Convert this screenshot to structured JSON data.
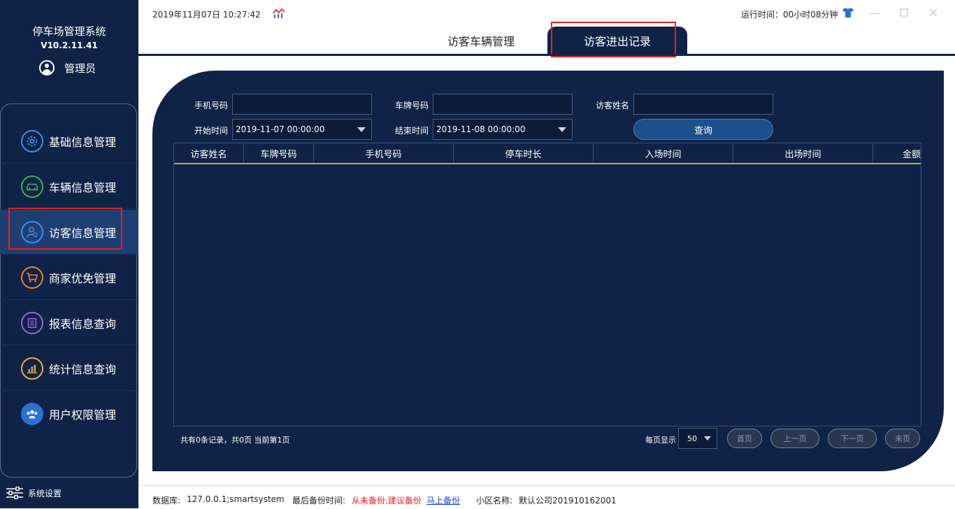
{
  "app": {
    "title": "停车场管理系统",
    "version": "V10.2.11.41",
    "user": "管理员"
  },
  "sidebar": {
    "items": [
      {
        "label": "基础信息管理",
        "icon": "gear-icon",
        "color": "#3f8ee8"
      },
      {
        "label": "车辆信息管理",
        "icon": "car-icon",
        "color": "#3fae5a"
      },
      {
        "label": "访客信息管理",
        "icon": "visitor-icon",
        "color": "#3f8ee8"
      },
      {
        "label": "商家优免管理",
        "icon": "cart-icon",
        "color": "#e8822f"
      },
      {
        "label": "报表信息查询",
        "icon": "report-icon",
        "color": "#8f6bd6"
      },
      {
        "label": "统计信息查询",
        "icon": "bar-chart-icon",
        "color": "#e0b43a"
      },
      {
        "label": "用户权限管理",
        "icon": "users-icon",
        "color": "#3f8ee8"
      }
    ],
    "active_index": 2,
    "settings_label": "系统设置"
  },
  "topbar": {
    "datetime": "2019年11月07日 10:27:42",
    "runtime": "运行时间：00小时08分钟"
  },
  "tabs": [
    {
      "label": "访客车辆管理",
      "active": false
    },
    {
      "label": "访客进出记录",
      "active": true
    }
  ],
  "filters": {
    "phone_label": "手机号码",
    "phone_value": "",
    "plate_label": "车牌号码",
    "plate_value": "",
    "visitor_label": "访客姓名",
    "visitor_value": "",
    "start_label": "开始时间",
    "start_value": "2019-11-07 00:00:00",
    "end_label": "结束时间",
    "end_value": "2019-11-08 00:00:00",
    "query_label": "查询"
  },
  "table": {
    "columns": [
      "访客姓名",
      "车牌号码",
      "手机号码",
      "停车时长",
      "入场时间",
      "出场时间",
      "金额"
    ],
    "rows": []
  },
  "pagination": {
    "summary": "共有0条记录，共0页 当前第1页",
    "per_page_label": "每页显示",
    "per_page_value": "50",
    "first": "首页",
    "prev": "上一页",
    "next": "下一页",
    "last": "末页"
  },
  "status": {
    "db_label": "数据库:",
    "db_value": "127.0.0.1;smartsystem",
    "backup_label": "最后备份时间:",
    "backup_value": "从未备份,建议备份",
    "backup_link": "马上备份",
    "community_label": "小区名称:",
    "community_value": "默认公司201910162001"
  },
  "colors": {
    "nav_bg": "#0f2346",
    "highlight": "#e8211d",
    "warning_text": "#e8211d",
    "link": "#1a3fd4"
  }
}
